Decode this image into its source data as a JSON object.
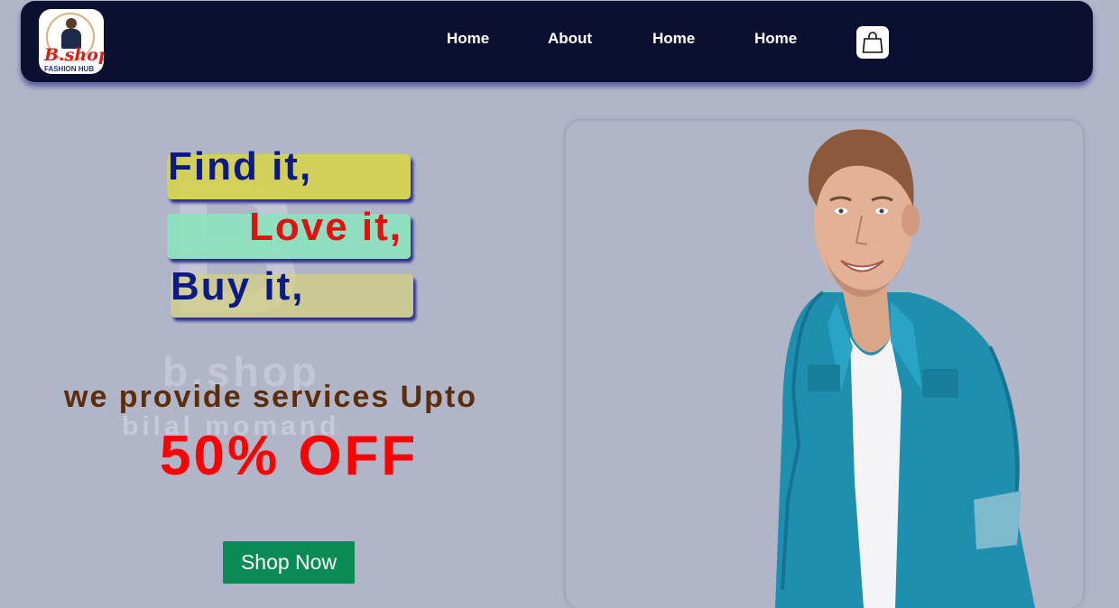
{
  "navbar": {
    "logo": {
      "brand": "B.shop",
      "tagline": "FASHION HUB"
    },
    "links": [
      "Home",
      "About",
      "Home",
      "Home"
    ],
    "cart_icon": "shopping-bag-icon"
  },
  "hero": {
    "watermark": {
      "letter": "B",
      "name": "b.shop",
      "sub": "bilal momand"
    },
    "taglines": [
      "Find it,",
      "Love it,",
      "Buy it,"
    ],
    "promo_text": "we provide services Upto",
    "discount": "50% OFF",
    "cta_label": "Shop Now",
    "image": "smiling man in denim shirt"
  },
  "colors": {
    "navbar_bg": "#0c1030",
    "page_bg": "#b1b5c8",
    "tagline_blue": "#0d1a86",
    "tagline_red": "#e41010",
    "discount_red": "#ff0000",
    "cta_green": "#0a8a55"
  }
}
